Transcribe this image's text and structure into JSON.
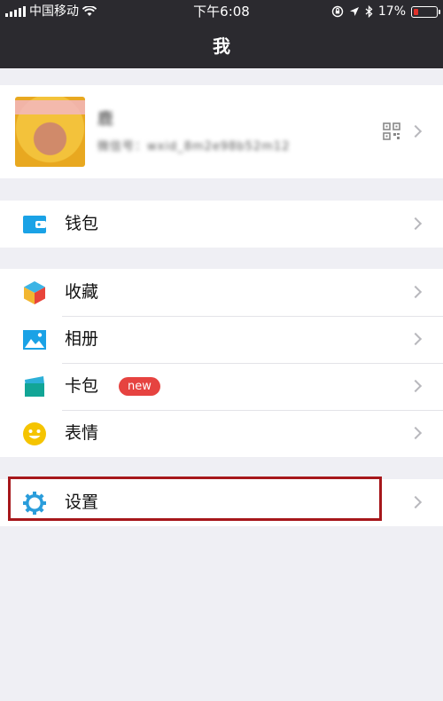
{
  "status_bar": {
    "carrier": "中国移动",
    "time": "下午6:08",
    "battery_percent": "17%",
    "battery_level": 0.17
  },
  "nav": {
    "title": "我"
  },
  "profile": {
    "name": "鹿",
    "wechat_id": "微信号：wxid_8m2e98b52m12"
  },
  "menu": {
    "wallet": {
      "label": "钱包"
    },
    "favorites": {
      "label": "收藏"
    },
    "album": {
      "label": "相册"
    },
    "cards": {
      "label": "卡包",
      "badge": "new"
    },
    "stickers": {
      "label": "表情"
    },
    "settings": {
      "label": "设置"
    }
  },
  "colors": {
    "header_bg": "#2b2a2f",
    "badge_red": "#e64340",
    "highlight_border": "#a6171b",
    "icon_blue": "#1aa2e6"
  }
}
